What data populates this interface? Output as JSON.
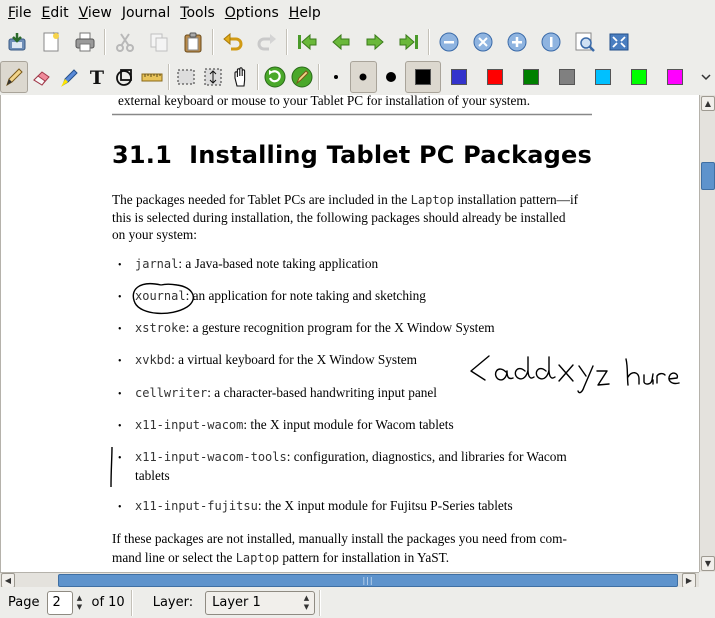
{
  "menu": [
    {
      "label": "File",
      "mnemonic": "F",
      "rest": "ile"
    },
    {
      "label": "Edit",
      "mnemonic": "E",
      "rest": "dit"
    },
    {
      "label": "View",
      "mnemonic": "V",
      "rest": "iew"
    },
    {
      "label": "Journal",
      "mnemonic": "J",
      "rest": "ournal"
    },
    {
      "label": "Tools",
      "mnemonic": "T",
      "rest": "ools"
    },
    {
      "label": "Options",
      "mnemonic": "O",
      "rest": "ptions"
    },
    {
      "label": "Help",
      "mnemonic": "H",
      "rest": "elp"
    }
  ],
  "toolbar1": [
    "save-icon",
    "new-page-icon",
    "print-icon",
    "cut-icon",
    "copy-icon",
    "paste-icon",
    "undo-icon",
    "redo-icon",
    "first-page-icon",
    "previous-page-icon",
    "next-page-icon",
    "last-page-icon",
    "zoom-out-icon",
    "zoom-fit-icon",
    "zoom-in-icon",
    "zoom-100-icon",
    "zoom-custom-icon",
    "fullscreen-icon"
  ],
  "toolbar2": {
    "tools": [
      "pen-icon",
      "eraser-icon",
      "highlighter-icon",
      "text-tool-icon",
      "shape-recognizer-icon",
      "ruler-icon",
      "select-rectangle-icon",
      "vertical-space-icon",
      "hand-tool-icon",
      "default-tool-icon",
      "default-pen-icon"
    ],
    "active_tool": "pen",
    "palette": [
      "#000000",
      "#3333cc",
      "#ff0000",
      "#008000",
      "#808080",
      "#00c0ff",
      "#00ff00",
      "#ff00ff"
    ],
    "selected_color": "#000000",
    "thickness_selected": "medium"
  },
  "document": {
    "top_line": "external keyboard or mouse to your Tablet PC for installation of your system.",
    "heading_num": "31.1",
    "heading_text": "Installing Tablet PC Packages",
    "intro_1": "The packages needed for Tablet PCs are included in the ",
    "intro_code": "Laptop",
    "intro_2": " installation pattern—if",
    "intro_line2": "this is selected during installation, the following packages should already be installed",
    "intro_line3": "on your system:",
    "bullets": [
      {
        "code": "jarnal",
        "text": ": a Java-based note taking application"
      },
      {
        "code": "xournal",
        "text": ": an application for note taking and sketching"
      },
      {
        "code": "xstroke",
        "text": ": a gesture recognition program for the X Window System"
      },
      {
        "code": "xvkbd",
        "text": ": a virtual keyboard for the X Window System"
      },
      {
        "code": "cellwriter",
        "text": ": a character-based handwriting input panel"
      },
      {
        "code": "x11-input-wacom",
        "text": ": the X input module for Wacom tablets"
      },
      {
        "code": "x11-input-wacom-tools",
        "text": ": configuration, diagnostics, and libraries for Wacom"
      },
      {
        "code": "x11-input-fujitsu",
        "text": ": the X input module for Fujitsu P-Series tablets"
      }
    ],
    "bullet_7_cont": "tablets",
    "outro_line1": "If these packages are not installed, manually install the packages you need from com-",
    "outro_2a": "mand line or select the ",
    "outro_code": "Laptop",
    "outro_2b": " pattern for installation in YaST.",
    "annotation": "<add xyz here"
  },
  "status": {
    "page_label": "Page",
    "page_value": "2",
    "of_label": "of 10",
    "layer_label": "Layer:",
    "layer_value": "Layer 1"
  }
}
